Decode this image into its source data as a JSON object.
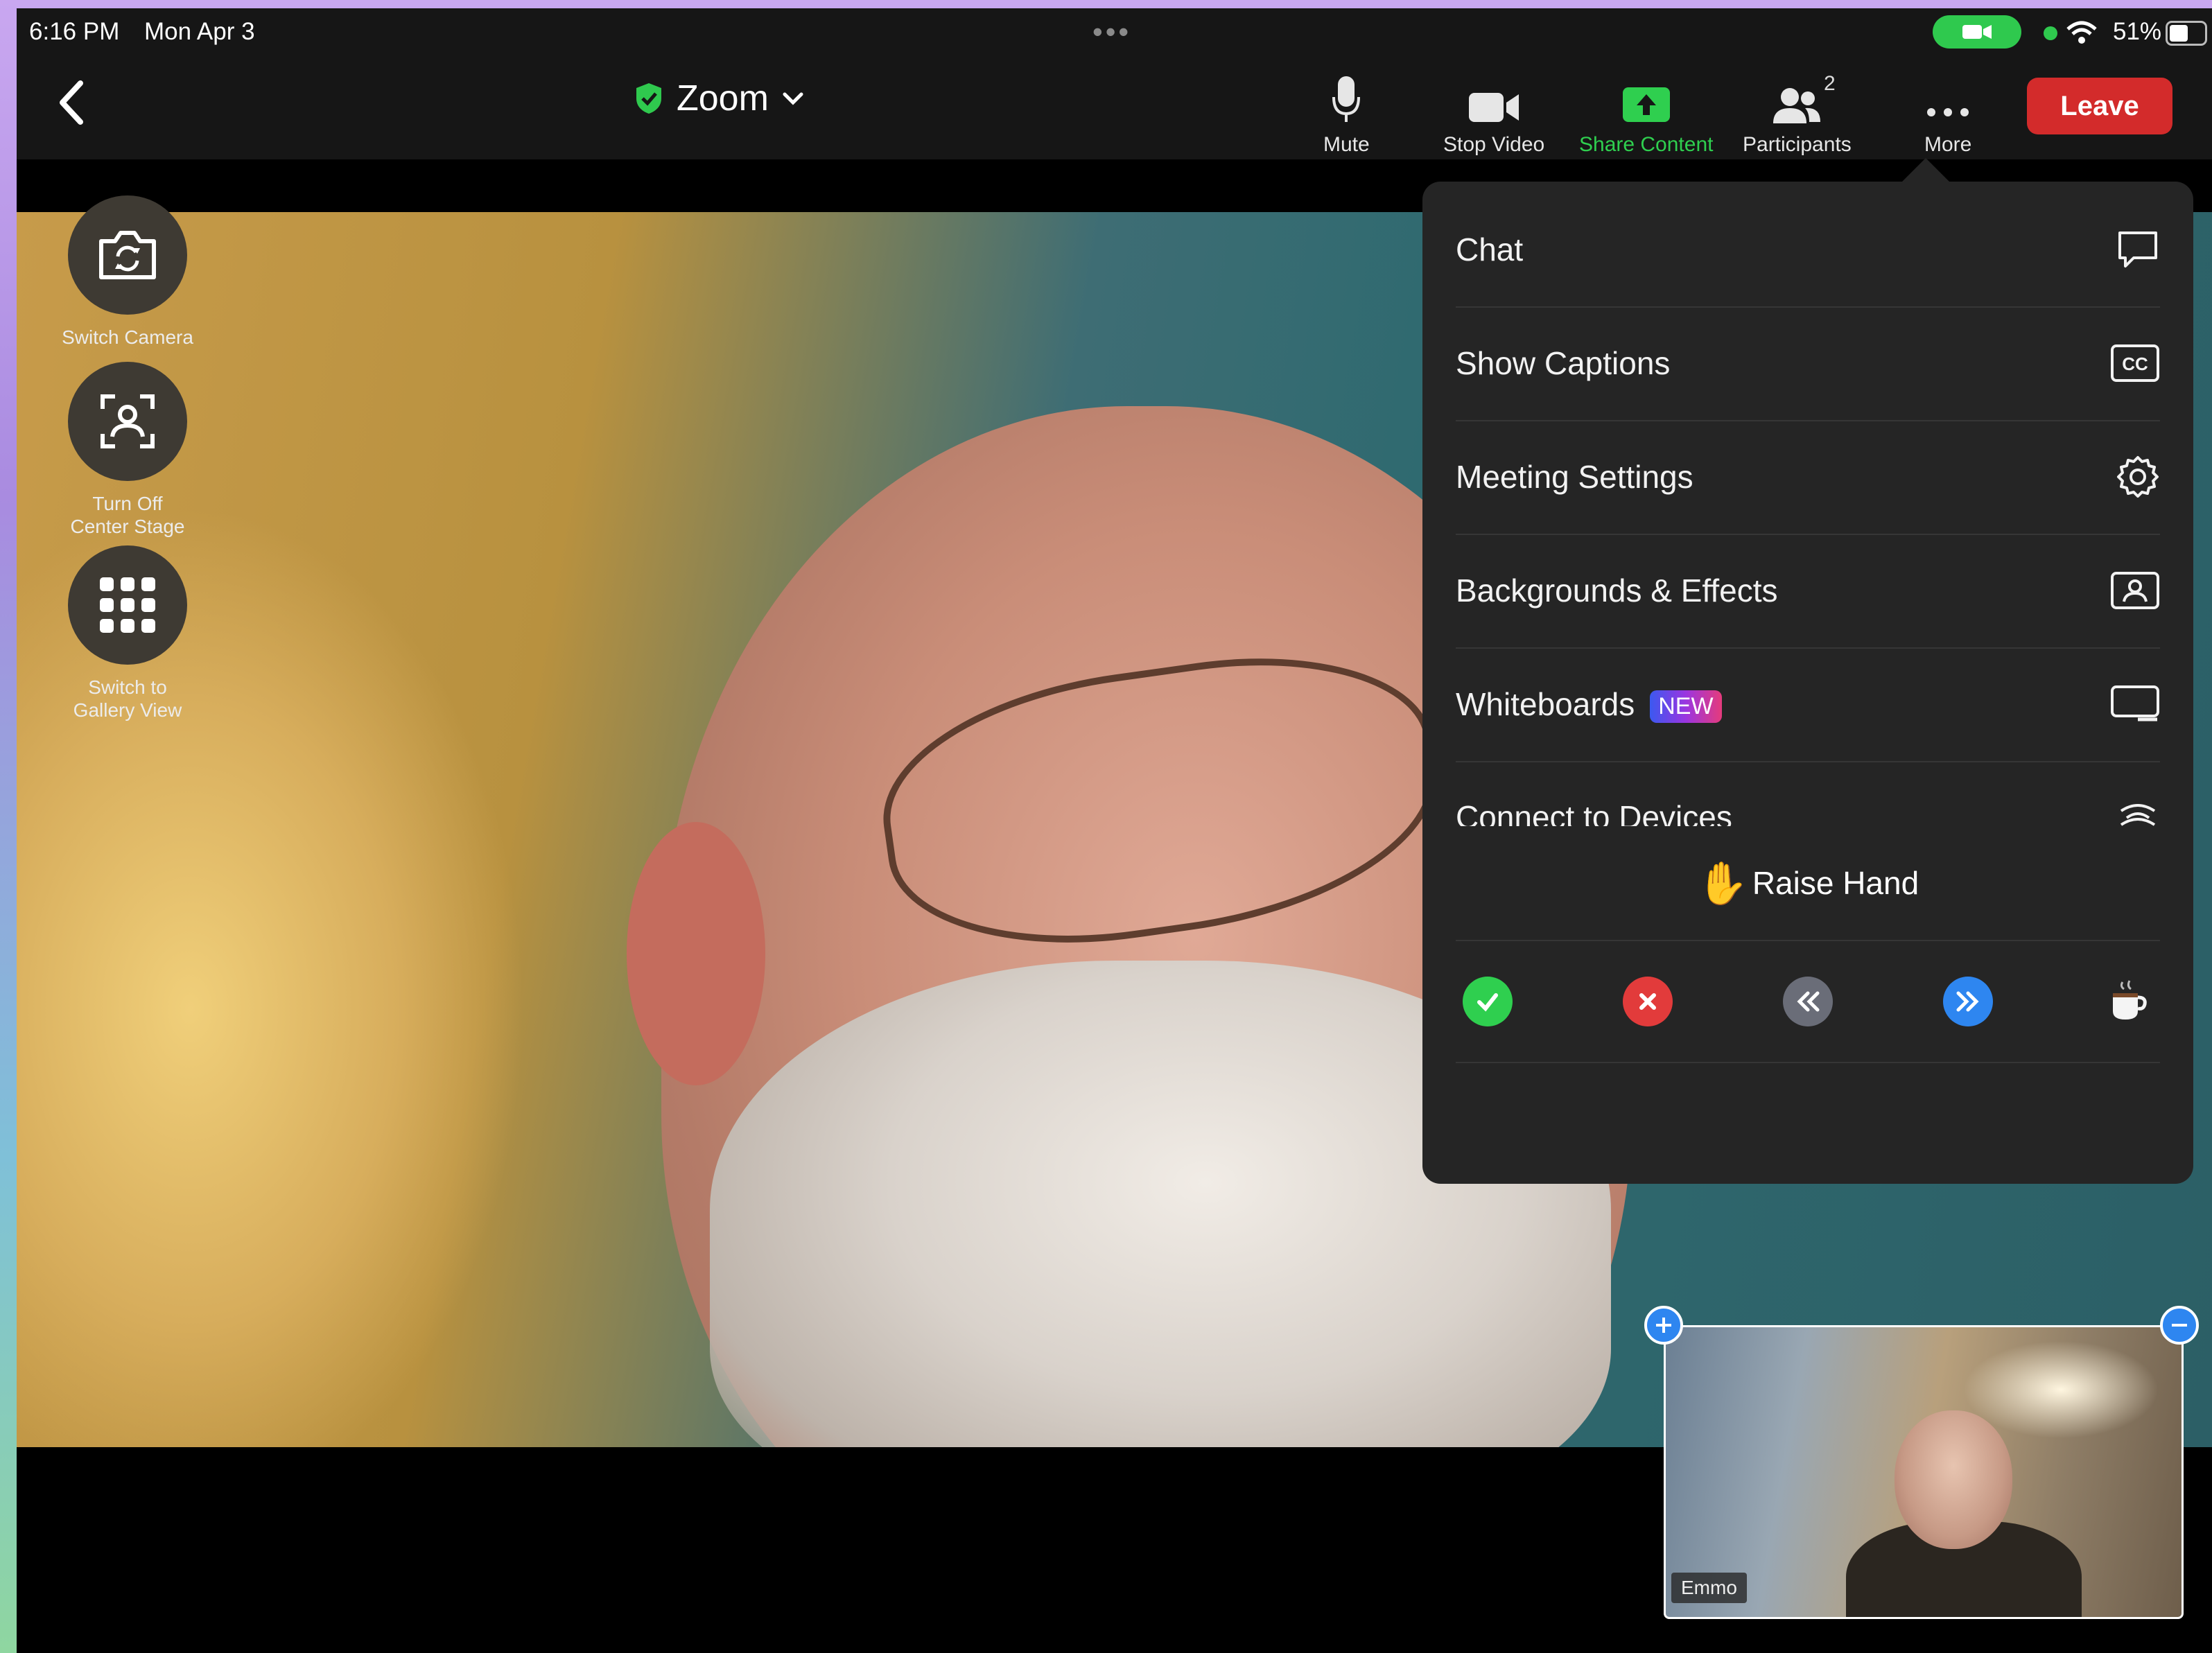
{
  "status_bar": {
    "time": "6:16 PM",
    "date": "Mon Apr 3",
    "battery": "51%"
  },
  "header": {
    "title": "Zoom",
    "buttons": {
      "mute": "Mute",
      "stop_video": "Stop Video",
      "share_content": "Share Content",
      "participants": "Participants",
      "participants_count": "2",
      "more": "More"
    },
    "leave": "Leave"
  },
  "side_controls": {
    "switch_camera": "Switch Camera",
    "center_stage_line1": "Turn Off",
    "center_stage_line2": "Center Stage",
    "gallery_line1": "Switch to",
    "gallery_line2": "Gallery View"
  },
  "more_menu": {
    "items": [
      {
        "label": "Chat",
        "icon": "chat-bubble-icon"
      },
      {
        "label": "Show Captions",
        "icon": "cc-icon"
      },
      {
        "label": "Meeting Settings",
        "icon": "gear-icon"
      },
      {
        "label": "Backgrounds & Effects",
        "icon": "portrait-icon"
      },
      {
        "label": "Whiteboards",
        "icon": "whiteboard-icon",
        "badge": "NEW"
      },
      {
        "label": "Connect to Devices",
        "icon": "wireless-icon"
      }
    ],
    "raise_hand": "Raise Hand",
    "raise_hand_emoji": "✋",
    "status_icons": [
      "check-icon",
      "x-icon",
      "slower-icon",
      "faster-icon",
      "coffee-icon"
    ],
    "reactions": [
      "👏",
      "👍",
      "❤️",
      "😂",
      "😮",
      "🎉"
    ]
  },
  "self_view": {
    "name": "Emmo"
  },
  "colors": {
    "accent_green": "#2fcf4f",
    "leave_red": "#d32b2b",
    "menu_bg": "#252525"
  }
}
